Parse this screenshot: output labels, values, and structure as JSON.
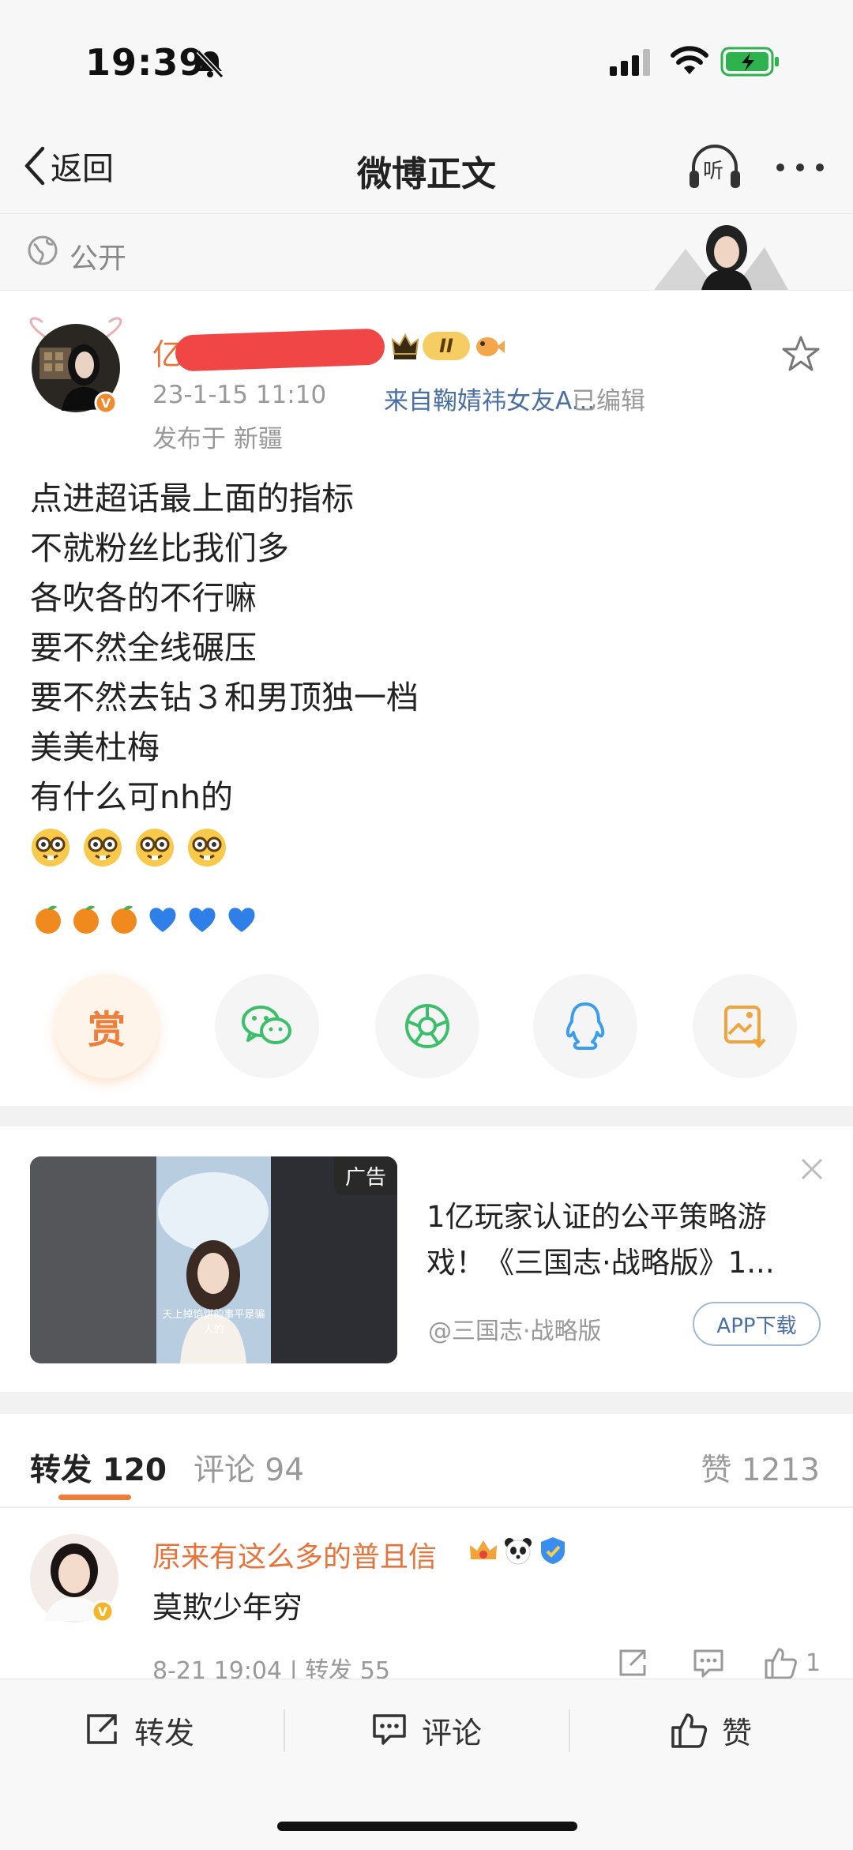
{
  "status_bar": {
    "time": "19:39"
  },
  "nav": {
    "back_label": "返回",
    "title": "微博正文",
    "listen_label": "听"
  },
  "visibility": {
    "label": "公开"
  },
  "post": {
    "author_name": "亿",
    "time": "23-1-15 11:10",
    "source": "来自鞠婧祎女友A...",
    "edited": "已编辑",
    "location": "发布于 新疆",
    "lines": [
      "点进超话最上面的指标",
      "不就粉丝比我们多",
      "各吹各的不行嘛",
      "要不然全线碾压",
      "要不然去钻３和男顶独一档",
      "美美杜梅",
      "有什么可nh的"
    ],
    "emoji_row": [
      "🍊",
      "🍊",
      "🍊",
      "💙",
      "💙",
      "💙"
    ],
    "member_level": "II"
  },
  "share": {
    "reward_label": "赏"
  },
  "ad": {
    "tag": "广告",
    "title": "1亿玩家认证的公平策略游戏！《三国志·战略版》1...",
    "advertiser": "@三国志·战略版",
    "download_label": "APP下载",
    "caption": "天上掉馅饼的事平是骗人的"
  },
  "tabs": {
    "repost": "转发 120",
    "comment": "评论 94",
    "like": "赞 1213"
  },
  "repost_item": {
    "user": "原来有这么多的普且信",
    "text": "莫欺少年穷",
    "meta": "8-21 19:04 | 转发 55",
    "like_count": "1"
  },
  "bottom_bar": {
    "repost": "转发",
    "comment": "评论",
    "like": "赞"
  },
  "colors": {
    "accent": "#ef7e3b",
    "link": "#4a6fa5",
    "name": "#e8733a"
  }
}
